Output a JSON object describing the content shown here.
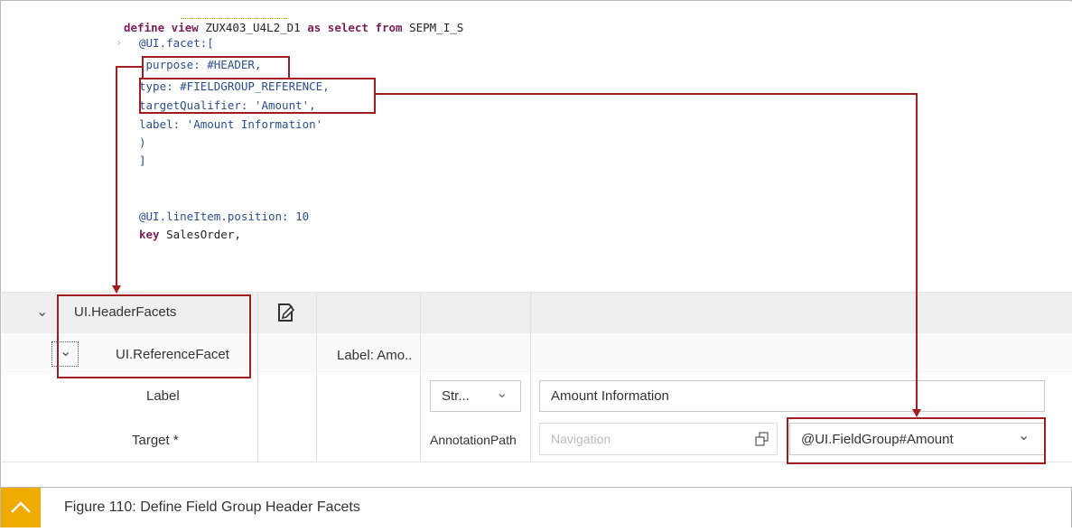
{
  "code": {
    "line1_kw1": "define view",
    "line1_name": " ZUX403_U4L2_D1 ",
    "line1_kw2": "as select from",
    "line1_src": " SEPM_I_S",
    "line2": "@UI.facet:[",
    "line3": " purpose: #HEADER,",
    "line4": "type: #FIELDGROUP_REFERENCE,",
    "line5": "targetQualifier: 'Amount',",
    "line6": "label: 'Amount Information'",
    "line7": ")",
    "line8": "]",
    "line9": "@UI.lineItem.position: 10",
    "line10_kw": "key",
    "line10_rest": " SalesOrder,"
  },
  "table": {
    "header_facets": "UI.HeaderFacets",
    "reference_facet": "UI.ReferenceFacet",
    "label_summary": "Label: Amo..",
    "label_row_name": "Label",
    "label_type": "Str...",
    "label_value": "Amount Information",
    "target_row_name": "Target",
    "target_required": "*",
    "target_type": "AnnotationPath",
    "navigation_placeholder": "Navigation",
    "target_value": "@UI.FieldGroup#Amount"
  },
  "caption": {
    "text": "Figure 110: Define Field Group Header Facets"
  },
  "colors": {
    "highlight": "#a01e22",
    "caption_icon": "#f0ab00"
  },
  "icons": [
    "edit-icon",
    "chevron-down-icon",
    "open-dialog-icon",
    "chevron-up-icon"
  ]
}
